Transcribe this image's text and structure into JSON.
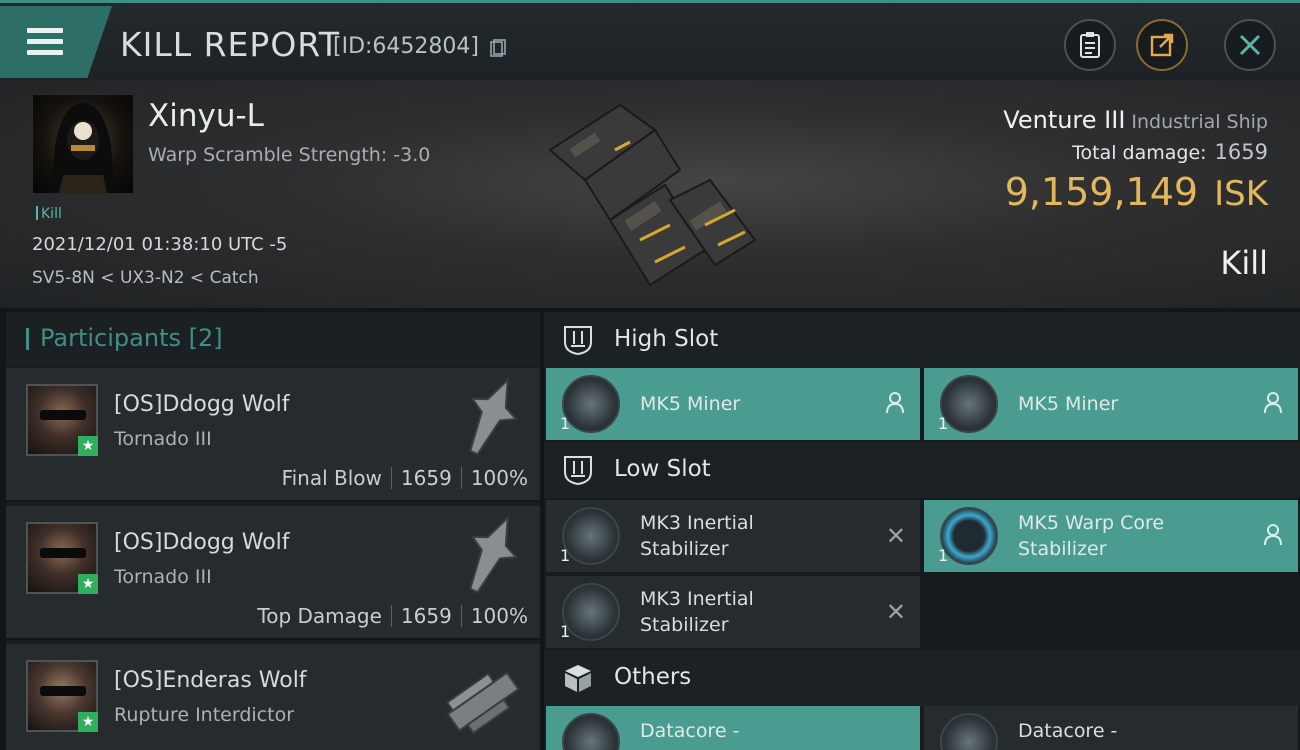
{
  "header": {
    "title": "KILL REPORT",
    "report_id": "[ID:6452804]"
  },
  "victim": {
    "pilot_name": "Xinyu-L",
    "warp_scramble": "Warp Scramble Strength: -3.0",
    "tag": "Kill",
    "datetime": "2021/12/01 01:38:10 UTC -5",
    "location": "SV5-8N < UX3-N2 < Catch",
    "ship_name": "Venture III",
    "ship_class": "Industrial Ship",
    "total_damage_label": "Total damage:",
    "total_damage": "1659",
    "isk_value": "9,159,149",
    "isk_unit": "ISK",
    "result": "Kill"
  },
  "participants": {
    "label": "Participants",
    "count": "[2]",
    "rows": [
      {
        "name": "[OS]Ddogg Wolf",
        "ship": "Tornado III",
        "role": "Final Blow",
        "damage": "1659",
        "percent": "100%"
      },
      {
        "name": "[OS]Ddogg Wolf",
        "ship": "Tornado III",
        "role": "Top Damage",
        "damage": "1659",
        "percent": "100%"
      },
      {
        "name": "[OS]Enderas Wolf",
        "ship": "Rupture Interdictor"
      }
    ]
  },
  "slots": {
    "high": {
      "label": "High Slot",
      "items": [
        {
          "name": "MK5 Miner",
          "qty": "1"
        },
        {
          "name": "MK5 Miner",
          "qty": "1"
        }
      ]
    },
    "low": {
      "label": "Low Slot",
      "items": [
        {
          "name_line1": "MK3 Inertial",
          "name_line2": "Stabilizer",
          "qty": "1"
        },
        {
          "name_line1": "MK5 Warp Core",
          "name_line2": "Stabilizer",
          "qty": "1"
        },
        {
          "name_line1": "MK3 Inertial",
          "name_line2": "Stabilizer",
          "qty": "1"
        }
      ]
    },
    "others": {
      "label": "Others",
      "items": [
        {
          "name": "Datacore -"
        },
        {
          "name": "Datacore -"
        }
      ]
    }
  },
  "icons": [
    "menu-icon",
    "copy-icon",
    "clipboard-icon",
    "share-icon",
    "close-icon",
    "slot-shield-icon",
    "cube-icon",
    "person-icon",
    "x-icon"
  ],
  "colors": {
    "accent": "#3f8f86",
    "isk": "#e3b75b",
    "owned_item": "#4a9c90"
  }
}
